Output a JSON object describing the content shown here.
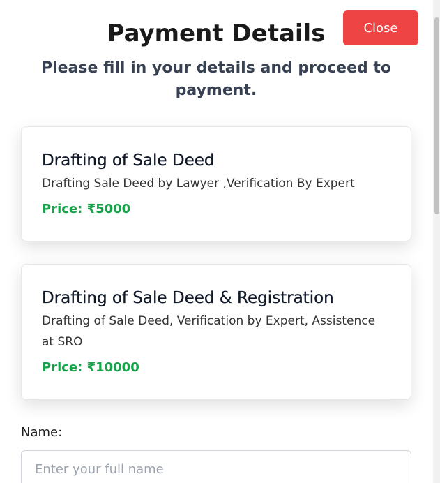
{
  "header": {
    "title": "Payment Details",
    "subtitle": "Please fill in your details and proceed to payment.",
    "close_label": "Close"
  },
  "services": [
    {
      "title": "Drafting of Sale Deed",
      "description": "Drafting Sale Deed by Lawyer ,Verification By Expert",
      "price": "Price: ₹5000"
    },
    {
      "title": "Drafting of Sale Deed & Registration",
      "description": "Drafting of Sale Deed, Verification by Expert, Assistence at SRO",
      "price": "Price: ₹10000"
    }
  ],
  "form": {
    "name_label": "Name:",
    "name_placeholder": "Enter your full name",
    "name_value": ""
  },
  "colors": {
    "close_button": "#ef4444",
    "price": "#16a34a"
  }
}
